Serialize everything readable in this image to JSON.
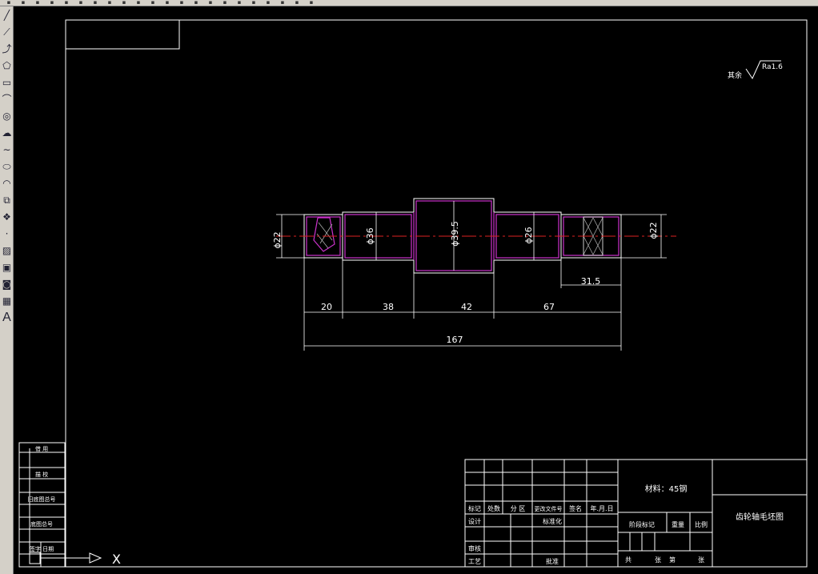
{
  "toolbar": {
    "icons": [
      "new-icon",
      "open-icon",
      "save-icon",
      "print-icon",
      "preview-icon",
      "publish-icon",
      "cut-icon",
      "copy-icon",
      "paste-icon",
      "match-prop-icon",
      "undo-icon",
      "redo-icon",
      "pan-icon",
      "zoom-realtime-icon",
      "zoom-window-icon",
      "zoom-previous-icon",
      "properties-icon",
      "design-center-icon",
      "tool-palette-icon",
      "calculator-icon",
      "layer-icon",
      "color-icon"
    ]
  },
  "sidebar": {
    "tools": [
      {
        "name": "line-tool",
        "glyph": "╱"
      },
      {
        "name": "construction-line-tool",
        "glyph": "⟋"
      },
      {
        "name": "polyline-tool",
        "glyph": "⤴"
      },
      {
        "name": "polygon-tool",
        "glyph": "⬠"
      },
      {
        "name": "rectangle-tool",
        "glyph": "▭"
      },
      {
        "name": "arc-tool",
        "glyph": "⌒"
      },
      {
        "name": "circle-tool",
        "glyph": "◎"
      },
      {
        "name": "revision-cloud-tool",
        "glyph": "☁"
      },
      {
        "name": "spline-tool",
        "glyph": "∼"
      },
      {
        "name": "ellipse-tool",
        "glyph": "⬭"
      },
      {
        "name": "ellipse-arc-tool",
        "glyph": "◠"
      },
      {
        "name": "insert-block-tool",
        "glyph": "⧉"
      },
      {
        "name": "make-block-tool",
        "glyph": "❖"
      },
      {
        "name": "point-tool",
        "glyph": "·"
      },
      {
        "name": "hatch-tool",
        "glyph": "▨"
      },
      {
        "name": "gradient-tool",
        "glyph": "▣"
      },
      {
        "name": "region-tool",
        "glyph": "◙"
      },
      {
        "name": "table-tool",
        "glyph": "▦"
      },
      {
        "name": "multiline-text-tool",
        "glyph": "A"
      }
    ]
  },
  "drawing": {
    "roughness_note": "其余",
    "roughness_value": "Ra1.6",
    "dims": {
      "d_left": "ϕ22",
      "d_36": "ϕ36",
      "d_center": "ϕ39.5",
      "d_26": "ϕ26",
      "d_right": "ϕ22",
      "len_20": "20",
      "len_38": "38",
      "len_42": "42",
      "len_67": "67",
      "len_315": "31.5",
      "len_total": "167"
    }
  },
  "title_block": {
    "material": "材料：45钢",
    "drawing_name": "齿轮轴毛坯图",
    "col_headers": [
      "标记",
      "处数",
      "分 区",
      "更改文件号",
      "签名",
      "年.月.日"
    ],
    "design": "设计",
    "standardization": "标准化",
    "stage_mark": "阶段标记",
    "weight": "重量",
    "scale": "比例",
    "review": "审核",
    "process": "工艺",
    "approve": "批准",
    "total": "共",
    "sheets": "张",
    "sheet": "第",
    "sheet_unit": "张"
  },
  "left_panel": {
    "rows": [
      "借 用",
      "描 校",
      "旧底图总号",
      "底图总号",
      "签字 日期"
    ]
  },
  "ucs": {
    "x_label": "X"
  },
  "colors": {
    "background": "#000000",
    "lines": "#ffffff",
    "part_outline": "#cc33cc",
    "centerline": "#dd2222"
  }
}
